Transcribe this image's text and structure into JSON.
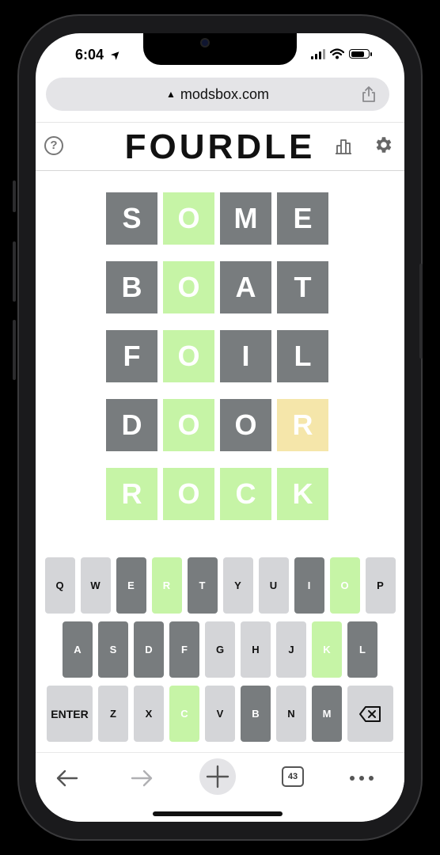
{
  "status_bar": {
    "time": "6:04",
    "location_glyph": "➤"
  },
  "browser": {
    "url": "modsbox.com",
    "lock_glyph": "▲",
    "tab_count": "43"
  },
  "header": {
    "title": "FOURDLE",
    "help_glyph": "?"
  },
  "colors": {
    "absent": "#787c7e",
    "correct": "#c6f4a6",
    "present": "#f5e6aa",
    "key_default": "#d4d5d8"
  },
  "board": {
    "rows": [
      {
        "letters": [
          "S",
          "O",
          "M",
          "E"
        ],
        "states": [
          "absent",
          "correct",
          "absent",
          "absent"
        ]
      },
      {
        "letters": [
          "B",
          "O",
          "A",
          "T"
        ],
        "states": [
          "absent",
          "correct",
          "absent",
          "absent"
        ]
      },
      {
        "letters": [
          "F",
          "O",
          "I",
          "L"
        ],
        "states": [
          "absent",
          "correct",
          "absent",
          "absent"
        ]
      },
      {
        "letters": [
          "D",
          "O",
          "O",
          "R"
        ],
        "states": [
          "absent",
          "correct",
          "absent",
          "present"
        ]
      },
      {
        "letters": [
          "R",
          "O",
          "C",
          "K"
        ],
        "states": [
          "correct",
          "correct",
          "correct",
          "correct"
        ]
      }
    ]
  },
  "keyboard": {
    "rows": [
      [
        {
          "label": "Q",
          "state": "default"
        },
        {
          "label": "W",
          "state": "default"
        },
        {
          "label": "E",
          "state": "absent"
        },
        {
          "label": "R",
          "state": "correct"
        },
        {
          "label": "T",
          "state": "absent"
        },
        {
          "label": "Y",
          "state": "default"
        },
        {
          "label": "U",
          "state": "default"
        },
        {
          "label": "I",
          "state": "absent"
        },
        {
          "label": "O",
          "state": "correct"
        },
        {
          "label": "P",
          "state": "default"
        }
      ],
      [
        {
          "label": "A",
          "state": "absent"
        },
        {
          "label": "S",
          "state": "absent"
        },
        {
          "label": "D",
          "state": "absent"
        },
        {
          "label": "F",
          "state": "absent"
        },
        {
          "label": "G",
          "state": "default"
        },
        {
          "label": "H",
          "state": "default"
        },
        {
          "label": "J",
          "state": "default"
        },
        {
          "label": "K",
          "state": "correct"
        },
        {
          "label": "L",
          "state": "absent"
        }
      ],
      [
        {
          "label": "ENTER",
          "state": "default"
        },
        {
          "label": "Z",
          "state": "default"
        },
        {
          "label": "X",
          "state": "default"
        },
        {
          "label": "C",
          "state": "correct"
        },
        {
          "label": "V",
          "state": "default"
        },
        {
          "label": "B",
          "state": "absent"
        },
        {
          "label": "N",
          "state": "default"
        },
        {
          "label": "M",
          "state": "absent"
        },
        {
          "label": "",
          "state": "default",
          "icon": "backspace-icon"
        }
      ]
    ]
  }
}
